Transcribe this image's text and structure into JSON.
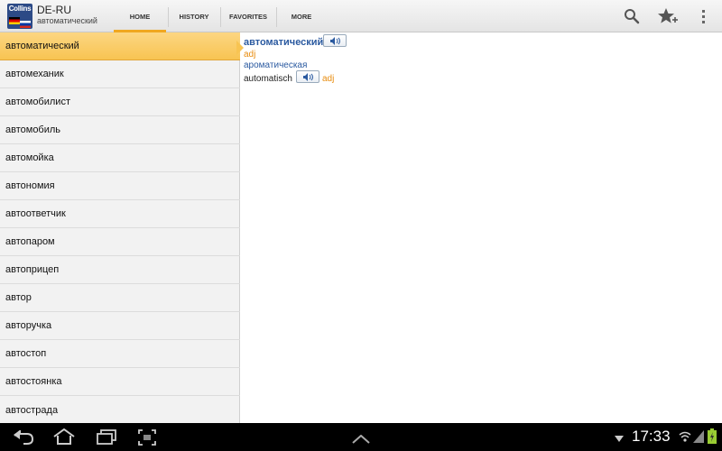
{
  "app": {
    "logo_text": "Collins",
    "title": "DE-RU",
    "subtitle": "автоматический"
  },
  "tabs": [
    {
      "label": "HOME",
      "active": true
    },
    {
      "label": "HISTORY",
      "active": false
    },
    {
      "label": "FAVORITES",
      "active": false
    },
    {
      "label": "MORE",
      "active": false
    }
  ],
  "actions": [
    "search-icon",
    "star-add-icon",
    "overflow-menu-icon"
  ],
  "word_list": [
    "автоматический",
    "автомеханик",
    "автомобилист",
    "автомобиль",
    "автомойка",
    "автономия",
    "автоответчик",
    "автопаром",
    "автоприцеп",
    "автор",
    "авторучка",
    "автостоп",
    "автостоянка",
    "автострада"
  ],
  "selected_index": 0,
  "entry": {
    "headword": "автоматический",
    "pos": "adj",
    "alt": "ароматическая",
    "translation": "automatisch",
    "translation_pos": "adj"
  },
  "system_bar": {
    "time": "17:33"
  },
  "colors": {
    "accent": "#f0a720",
    "selected_row": "#f8c452",
    "headword": "#2b5aa0",
    "pos": "#e88d10"
  }
}
